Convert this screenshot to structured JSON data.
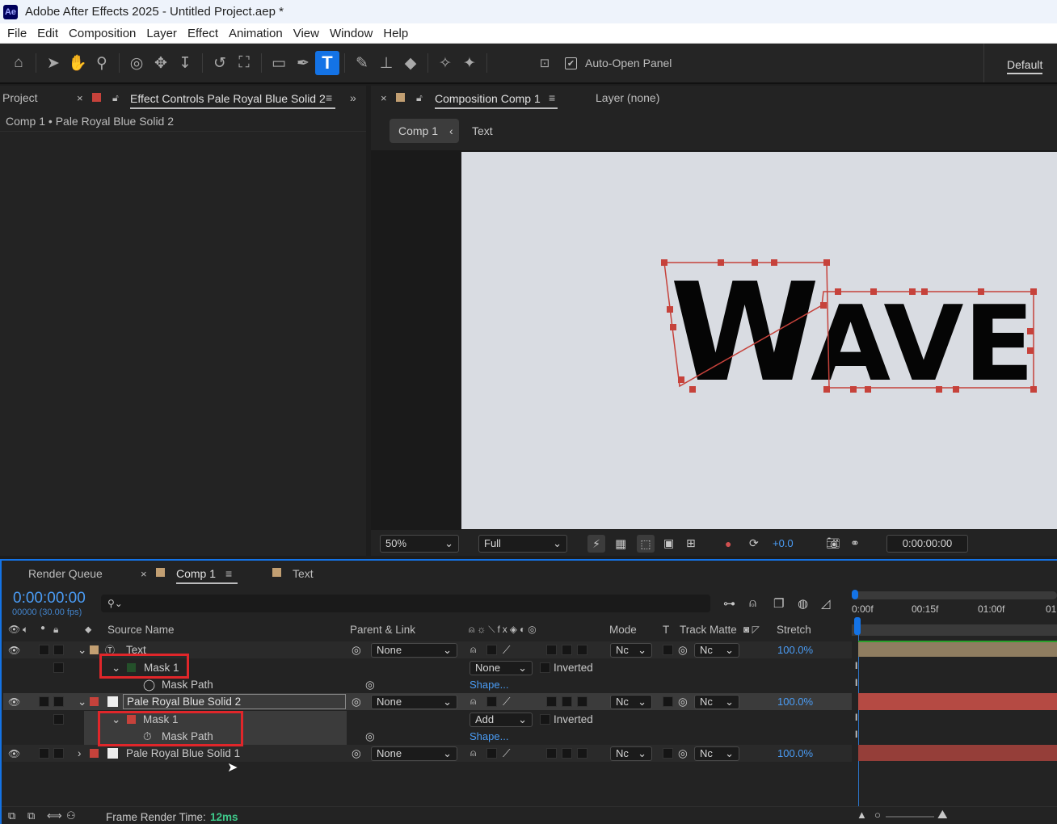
{
  "title": "Adobe After Effects 2025 - Untitled Project.aep *",
  "app_logo": "Ae",
  "menu": [
    "File",
    "Edit",
    "Composition",
    "Layer",
    "Effect",
    "Animation",
    "View",
    "Window",
    "Help"
  ],
  "toolbar": {
    "auto_open_label": "Auto-Open Panel",
    "workspace": "Default",
    "tools": [
      "home-icon",
      "selection-tool-icon",
      "hand-tool-icon",
      "zoom-tool-icon",
      "orbit-camera-icon",
      "pan-camera-icon",
      "dolly-camera-icon",
      "rotation-tool-icon",
      "anchor-point-tool-icon",
      "rectangle-tool-icon",
      "pen-tool-icon",
      "type-tool-icon",
      "brush-tool-icon",
      "clone-stamp-tool-icon",
      "eraser-tool-icon",
      "roto-brush-tool-icon",
      "puppet-pin-tool-icon"
    ]
  },
  "left_panel": {
    "tab_project": "Project",
    "tab_effect_controls": "Effect Controls Pale Royal Blue Solid 2",
    "subtitle": "Comp 1 • Pale Royal Blue Solid 2"
  },
  "comp_panel": {
    "tab_comp": "Composition Comp 1",
    "tab_layer": "Layer (none)",
    "breadcrumb_comp": "Comp 1",
    "breadcrumb_text": "Text",
    "canvas_text": "WAVE",
    "zoom": "50%",
    "resolution": "Full",
    "exposure": "+0.0",
    "timecode": "0:00:00:00"
  },
  "timeline": {
    "tab_render_queue": "Render Queue",
    "tab_comp": "Comp 1",
    "tab_text": "Text",
    "timecode": "0:00:00:00",
    "frames": "00000 (30.00 fps)",
    "headers": {
      "source_name": "Source Name",
      "parent_link": "Parent & Link",
      "mode": "Mode",
      "t": "T",
      "track_matte": "Track Matte",
      "stretch": "Stretch"
    },
    "ruler": [
      "0:00f",
      "00:15f",
      "01:00f",
      "01:"
    ],
    "layers": [
      {
        "name": "Text",
        "parent": "None",
        "mode": "Nc",
        "matte": "Nc",
        "stretch": "100.0%"
      },
      {
        "name": "Mask 1",
        "mode": "None",
        "inverted": "Inverted"
      },
      {
        "name": "Mask Path",
        "value": "Shape..."
      },
      {
        "name": "Pale Royal Blue Solid 2",
        "parent": "None",
        "mode": "Nc",
        "matte": "Nc",
        "stretch": "100.0%"
      },
      {
        "name": "Mask 1",
        "mode": "Add",
        "inverted": "Inverted"
      },
      {
        "name": "Mask Path",
        "value": "Shape..."
      },
      {
        "name": "Pale Royal Blue Solid 1",
        "parent": "None",
        "mode": "Nc",
        "matte": "Nc",
        "stretch": "100.0%"
      }
    ],
    "frame_render_label": "Frame Render Time:",
    "frame_render_value": "12ms"
  },
  "colors": {
    "accent_blue": "#1473e6",
    "layer_red": "#c6423b",
    "text_layer_tan": "#c29f72",
    "highlight_red": "#e0262a"
  }
}
